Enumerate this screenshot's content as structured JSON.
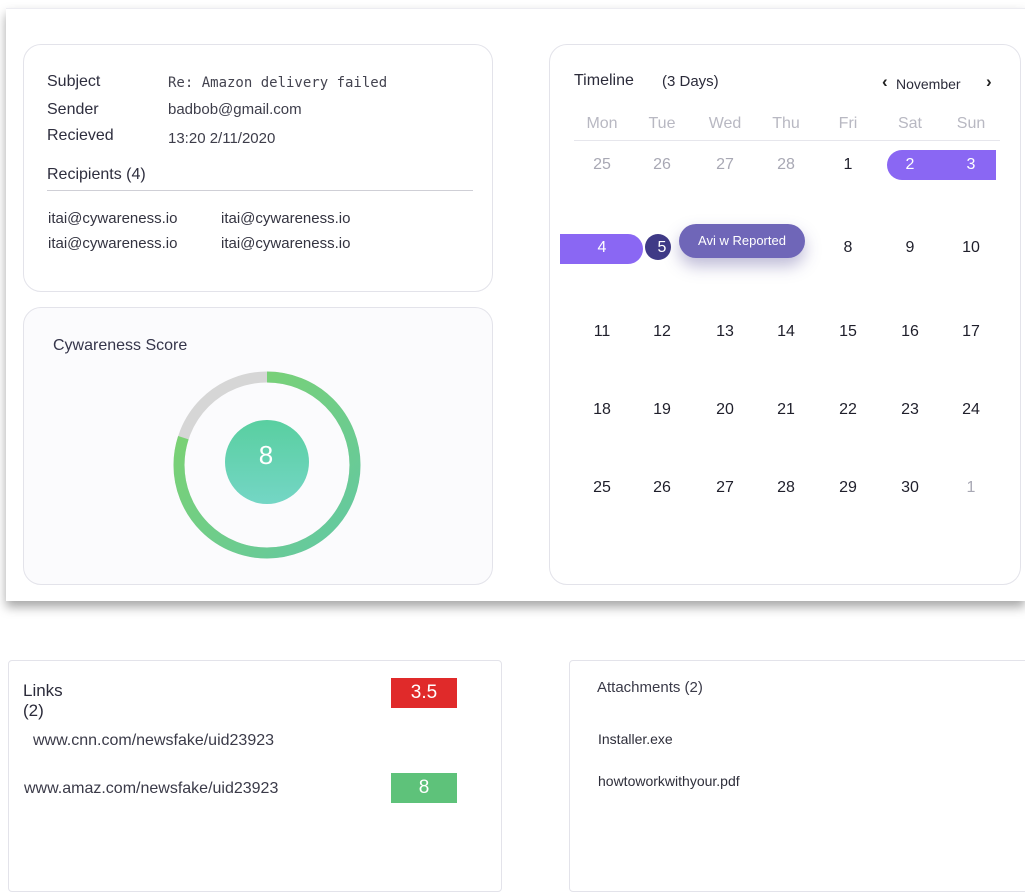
{
  "email": {
    "subject_label": "Subject",
    "subject_value": "Re: Amazon delivery failed",
    "sender_label": "Sender",
    "sender_value": "badbob@gmail.com",
    "received_label": "Recieved",
    "received_value": "13:20 2/11/2020",
    "recipients_label": "Recipients (4)",
    "recipients": [
      "itai@cywareness.io",
      "itai@cywareness.io",
      "itai@cywareness.io",
      "itai@cywareness.io"
    ]
  },
  "score": {
    "title": "Cywareness Score",
    "value": "8",
    "ring_fraction": 0.8,
    "colors": {
      "track": "#d6d6d6",
      "ring_start": "#62c8a4",
      "ring_end": "#7fd36a",
      "center_top": "#59cfa0",
      "center_bottom": "#74d6c5"
    }
  },
  "timeline": {
    "title": "Timeline",
    "range": "(3 Days)",
    "month": "November",
    "weekdays": [
      "Mon",
      "Tue",
      "Wed",
      "Thu",
      "Fri",
      "Sat",
      "Sun"
    ],
    "weeks": [
      [
        "25",
        "26",
        "27",
        "28",
        "1",
        "2",
        "3"
      ],
      [
        "4",
        "5",
        "6",
        "7",
        "8",
        "9",
        "10"
      ],
      [
        "11",
        "12",
        "13",
        "14",
        "15",
        "16",
        "17"
      ],
      [
        "18",
        "19",
        "20",
        "21",
        "22",
        "23",
        "24"
      ],
      [
        "25",
        "26",
        "27",
        "28",
        "29",
        "30",
        "1"
      ]
    ],
    "tooltip": "Avi w Reported",
    "selection_color": "#8a67f3",
    "today_color": "#3f3a86"
  },
  "links": {
    "title": "Links\n(2)",
    "items": [
      {
        "url": "www.cnn.com/newsfake/uid23923",
        "score": "3.5",
        "color": "#e02a2a"
      },
      {
        "url": "www.amaz.com/newsfake/uid23923",
        "score": "8",
        "color": "#5ec27a"
      }
    ]
  },
  "attachments": {
    "title": "Attachments (2)",
    "items": [
      "Installer.exe",
      "howtoworkwithyour.pdf"
    ]
  }
}
